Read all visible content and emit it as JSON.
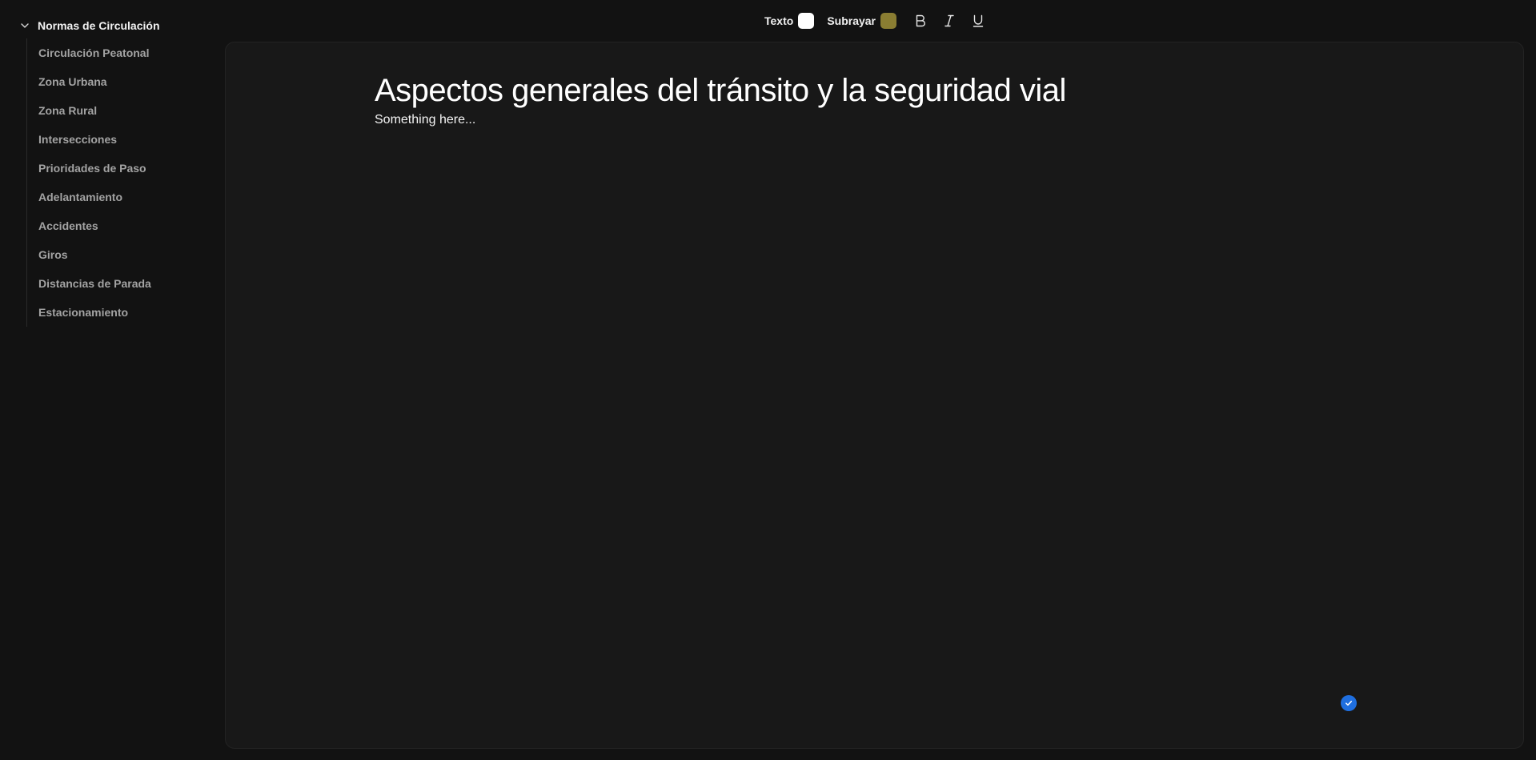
{
  "sidebar": {
    "section_title": "Normas de Circulación",
    "chevron_icon": "chevron-down-icon",
    "items": [
      {
        "label": "Circulación Peatonal"
      },
      {
        "label": "Zona Urbana"
      },
      {
        "label": "Zona Rural"
      },
      {
        "label": "Intersecciones"
      },
      {
        "label": "Prioridades de Paso"
      },
      {
        "label": "Adelantamiento"
      },
      {
        "label": "Accidentes"
      },
      {
        "label": "Giros"
      },
      {
        "label": "Distancias de Parada"
      },
      {
        "label": "Estacionamiento"
      }
    ]
  },
  "toolbar": {
    "text_label": "Texto",
    "text_color": "#ffffff",
    "highlight_label": "Subrayar",
    "highlight_color": "#8a7d32",
    "bold_icon": "bold-icon",
    "italic_icon": "italic-icon",
    "underline_icon": "underline-icon"
  },
  "document": {
    "title": "Aspectos generales del tránsito y la seguridad vial",
    "body": "Something here..."
  },
  "status": {
    "icon": "check-circle-icon",
    "color": "#1f6fe0"
  },
  "colors": {
    "background": "#121212",
    "editor_background": "#181818"
  }
}
